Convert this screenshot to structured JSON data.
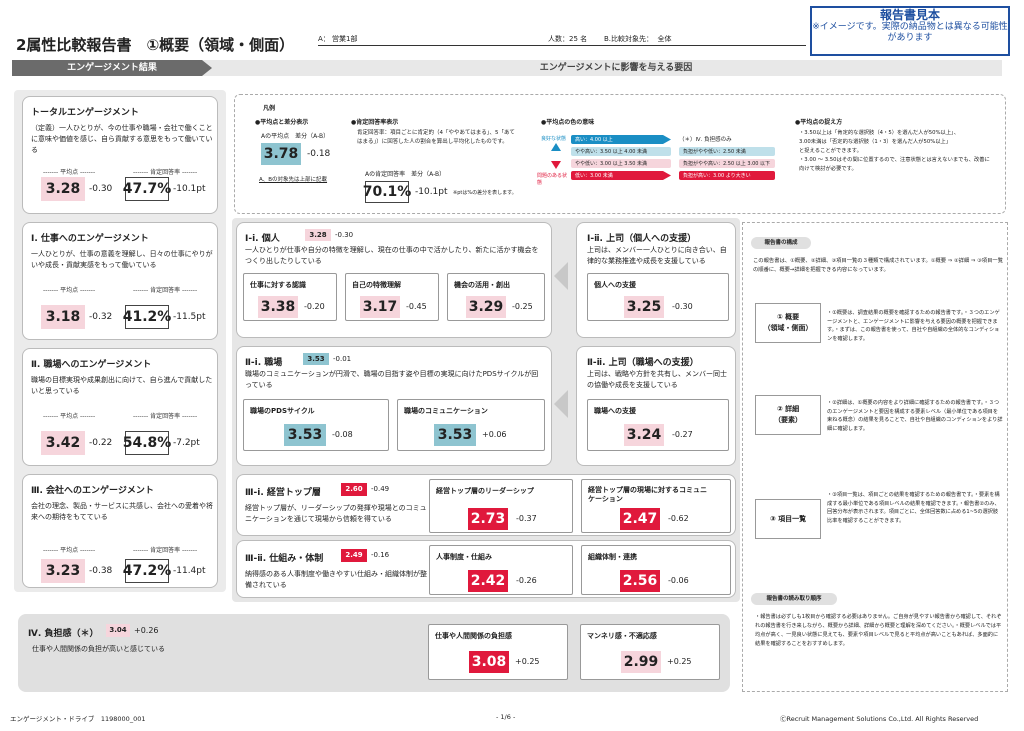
{
  "header": {
    "title": "2属性比較報告書　①概要（領域・側面）",
    "a_label": "A：",
    "a_value": "営業1部",
    "count": "人数：25 名",
    "b_label": "B.比較対象先：",
    "b_value": "全体",
    "sample_title": "報告書見本",
    "sample_note": "※イメージです。実際の納品物とは異なる可能性があります"
  },
  "band": {
    "left": "エンゲージメント結果",
    "right": "エンゲージメントに影響を与える要因"
  },
  "common": {
    "avg_label": "------- 平均点 -------",
    "pos_label": "------- 肯定回答率 -------"
  },
  "total": {
    "title": "トータルエンゲージメント",
    "desc": "（定義）一人ひとりが、今の仕事や職場・会社で働くことに意味や価値を感じ、自ら貢献する意思をもって働いている",
    "avg": "3.28",
    "avg_diff": "-0.30",
    "pos": "47.7%",
    "pos_diff": "-10.1pt"
  },
  "eng": [
    {
      "title": "Ⅰ. 仕事へのエンゲージメント",
      "desc": "一人ひとりが、仕事の意義を理解し、日々の仕事にやりがいや成長・貢献実感をもって働いている",
      "avg": "3.18",
      "avg_diff": "-0.32",
      "pos": "41.2%",
      "pos_diff": "-11.5pt"
    },
    {
      "title": "Ⅱ. 職場へのエンゲージメント",
      "desc": "職場の目標実現や成果創出に向けて、自ら進んで貢献したいと思っている",
      "avg": "3.42",
      "avg_diff": "-0.22",
      "pos": "54.8%",
      "pos_diff": "-7.2pt"
    },
    {
      "title": "Ⅲ. 会社へのエンゲージメント",
      "desc": "会社の理念、製品・サービスに共感し、会社への愛着や将来への期待をもてている",
      "avg": "3.23",
      "avg_diff": "-0.38",
      "pos": "47.2%",
      "pos_diff": "-11.4pt"
    }
  ],
  "legend": {
    "title": "凡例",
    "s1": "●平均点と差分表示",
    "s1_label": "Aの平均点　差分（A-B）",
    "s1_value": "3.78",
    "s1_diff": "-0.18",
    "s1_note": "A、Bの対象先は上部に記載",
    "s2": "●肯定回答率表示",
    "s2_desc": "肯定回答率：項目ごとに肯定的（4「ややあてはまる」、5「あてはまる」）に回答した人の割合を算出し平均化したものです。",
    "s2_label": "Aの肯定回答率　差分（A-B）",
    "s2_value": "70.1%",
    "s2_diff": "-10.1pt",
    "s2_note": "※ptは%の差分を表します。",
    "s3": "●平均点の色の意味",
    "good": "良好な状態",
    "bad": "問題のある状態",
    "iv_note": "（＊）Ⅳ. 負担感のみ",
    "bands_left": [
      "高い：4.00 以上",
      "やや高い：3.50 以上 4.00 未満",
      "やや低い：3.00 以上 3.50 未満",
      "低い：3.00 未満"
    ],
    "bands_right": [
      "負担がやや低い：2.50 未満",
      "負担がやや高い：2.50 以上 3.00 以下",
      "負担が高い：3.00 より大きい"
    ],
    "s4": "●平均点の捉え方",
    "s4_text": [
      "・3.50以上は「肯定的な選択肢（4・5）を選んだ人が50%以上」、",
      "3.00未満は「否定的な選択肢（1・3）を選んだ人が50%以上」",
      "と捉えることができます。",
      "・3.00 ～ 3.50はその間に位置するので、注意状態とは言えないまでも、改善に向けて検討が必要です。"
    ]
  },
  "factors": {
    "i_i": {
      "title": "Ⅰ-ⅰ. 個人",
      "avg": "3.28",
      "diff": "-0.30",
      "desc": "一人ひとりが仕事や自分の特徴を理解し、現在の仕事の中で活かしたり、新たに活かす機会をつくり出したりしている",
      "items": [
        {
          "label": "仕事に対する認識",
          "avg": "3.38",
          "diff": "-0.20"
        },
        {
          "label": "自己の特徴理解",
          "avg": "3.17",
          "diff": "-0.45"
        },
        {
          "label": "機会の活用・創出",
          "avg": "3.29",
          "diff": "-0.25"
        }
      ]
    },
    "i_ii": {
      "title": "Ⅰ-ⅱ. 上司（個人への支援）",
      "desc": "上司は、メンバー一人ひとりに向き合い、自律的な業務推進や成長を支援している",
      "items": [
        {
          "label": "個人への支援",
          "avg": "3.25",
          "diff": "-0.30"
        }
      ]
    },
    "ii_i": {
      "title": "Ⅱ-ⅰ. 職場",
      "avg": "3.53",
      "diff": "-0.01",
      "desc": "職場のコミュニケーションが円滑で、職場の目指す姿や目標の実現に向けたPDSサイクルが回っている",
      "items": [
        {
          "label": "職場のPDSサイクル",
          "avg": "3.53",
          "diff": "-0.08"
        },
        {
          "label": "職場のコミュニケーション",
          "avg": "3.53",
          "diff": "+0.06"
        }
      ]
    },
    "ii_ii": {
      "title": "Ⅱ-ⅱ. 上司（職場への支援）",
      "desc": "上司は、戦略や方針を共有し、メンバー同士の協働や成長を支援している",
      "items": [
        {
          "label": "職場への支援",
          "avg": "3.24",
          "diff": "-0.27"
        }
      ]
    },
    "iii_i": {
      "title": "Ⅲ-ⅰ. 経営トップ層",
      "avg": "2.60",
      "diff": "-0.49",
      "desc": "経営トップ層が、リーダーシップの発揮や現場とのコミュニケーションを通じて現場から信頼を得ている",
      "items": [
        {
          "label": "経営トップ層のリーダーシップ",
          "avg": "2.73",
          "diff": "-0.37"
        },
        {
          "label": "経営トップ層の現場に対するコミュニケーション",
          "avg": "2.47",
          "diff": "-0.62"
        }
      ]
    },
    "iii_ii": {
      "title": "Ⅲ-ⅱ. 仕組み・体制",
      "avg": "2.49",
      "diff": "-0.16",
      "desc": "納得感のある人事制度や働きやすい仕組み・組織体制が整備されている",
      "items": [
        {
          "label": "人事制度・仕組み",
          "avg": "2.42",
          "diff": "-0.26"
        },
        {
          "label": "組織体制・連携",
          "avg": "2.56",
          "diff": "-0.06"
        }
      ]
    }
  },
  "burden": {
    "title": "Ⅳ. 負担感（＊）",
    "avg": "3.04",
    "diff": "+0.26",
    "desc": "仕事や人間関係の負担が高いと感じている",
    "items": [
      {
        "label": "仕事や人間関係の負担感",
        "avg": "3.08",
        "diff": "+0.25"
      },
      {
        "label": "マンネリ感・不適応感",
        "avg": "2.99",
        "diff": "+0.25"
      }
    ]
  },
  "side": {
    "structure_title": "報告書の構成",
    "structure_text": "この報告書は、①概要、②詳細、③項目一覧の３種類で構成されています。①概要 ⇒ ②詳細 ⇒ ③項目一覧の順番に、概要→詳細を把握できる内容になっています。",
    "parts": [
      {
        "name": "① 概要\n（領域・側面）",
        "text": "・①概要は、調査結果の概要を確認するための報告書です。・３つのエンゲージメントと、エンゲージメントに影響を与える要因の概要を把握できます。・まずは、この報告書を使って、自社や自組織の全体的なコンディションを確認します。"
      },
      {
        "name": "② 詳細\n（要素）",
        "text": "・②詳細は、①概要の内容をより詳細に確認するための報告書です。・３つのエンゲージメントと要因を構成する要素レベル（最小単位である項目を束ねる概念）の結果を見ることで、自社や自組織のコンディションをより詳細に確認します。"
      },
      {
        "name": "③ 項目一覧",
        "text": "・③項目一覧は、項目ごとの結果を確認するための報告書です。・要素を構成する最小単位である項目レベルの結果を確認できます。・報告書②のみ、回答分布が表示されます。項目ごとに、全体回答数に占める1~5の選択肢比率を確認することができます。"
      }
    ],
    "order_title": "報告書の読み取り順序",
    "order_text": "・報告書は必ずしも1枚目から確認する必要はありません。ご自身が見やすい報告書から確認して、それぞれの報告書を行き来しながら、概要から詳細、詳細から概要と理解を深めてください。・概要レベルでは平均点が高く、一見良い状態に見えても、要素や項目レベルで見ると平均点が高いこともあれば、多面的に結果を確認することをおすすめします。"
  },
  "footer": {
    "left": "エンゲージメント・ドライブ　1198000_001",
    "center": "- 1/6 -",
    "right": "ⒸRecruit Management Solutions Co.,Ltd. All Rights Reserved"
  },
  "colors": {
    "pink": "#f6d5dc",
    "blue": "#8ec4d0",
    "red": "#e0193c",
    "band": "#6b6b6b"
  }
}
